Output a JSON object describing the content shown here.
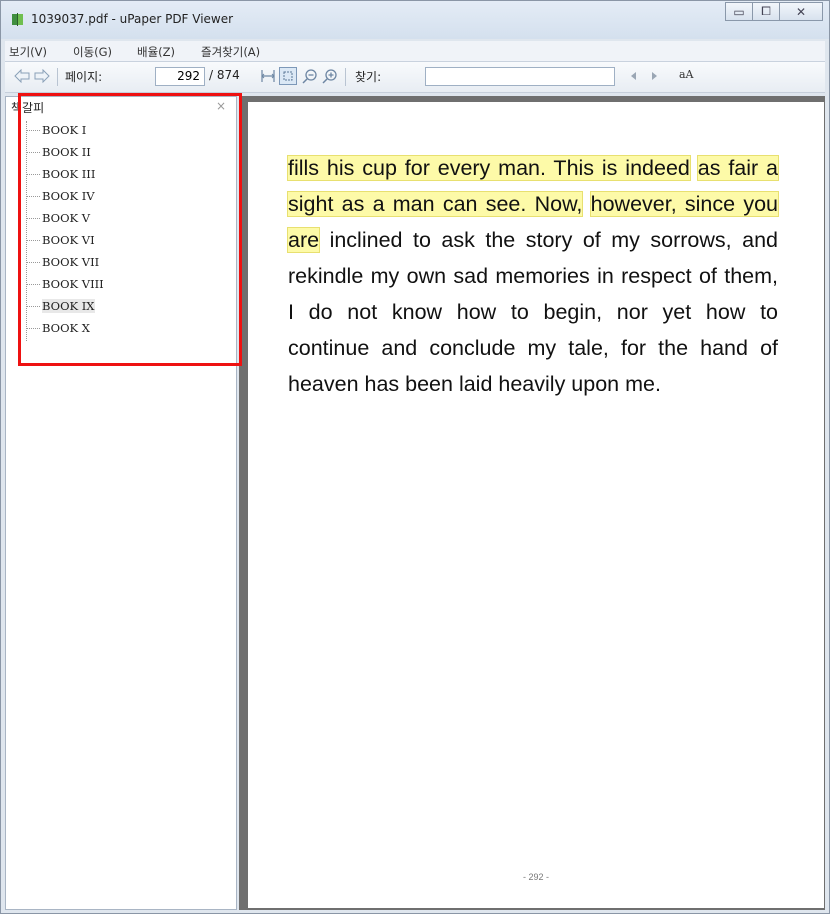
{
  "window": {
    "title": "1039037.pdf - uPaper PDF Viewer",
    "minimize_glyph": "▭",
    "maximize_glyph": "⧠",
    "close_glyph": "✕"
  },
  "menu": {
    "items": [
      "보기(V)",
      "이동(G)",
      "배율(Z)",
      "즐겨찾기(A)"
    ]
  },
  "toolbar": {
    "page_label": "페이지:",
    "page_value": "292",
    "page_total": "/ 874",
    "search_label": "찾기:",
    "search_value": "",
    "font_icon_text": "aA"
  },
  "sidebar": {
    "title": "책갈피",
    "close_glyph": "×",
    "bookmarks": [
      "BOOK I",
      "BOOK II",
      "BOOK III",
      "BOOK IV",
      "BOOK V",
      "BOOK VI",
      "BOOK VII",
      "BOOK VIII",
      "BOOK IX",
      "BOOK X"
    ],
    "selected_index": 8
  },
  "document": {
    "highlighted_1": "fills his cup for every man. This is indeed",
    "highlighted_2": "as fair a sight as a man can see. Now,",
    "highlighted_3": "however, since you are",
    "body_rest": " inclined to ask the story of my sorrows, and rekindle my own sad memories in respect of them, I do not know how to begin, nor yet how to continue and conclude my tale, for the hand of heaven has been laid heavily upon me.",
    "page_footer": "- 292 -"
  },
  "colors": {
    "highlight": "#fdfaa8",
    "annotation_box": "#ee1111"
  }
}
